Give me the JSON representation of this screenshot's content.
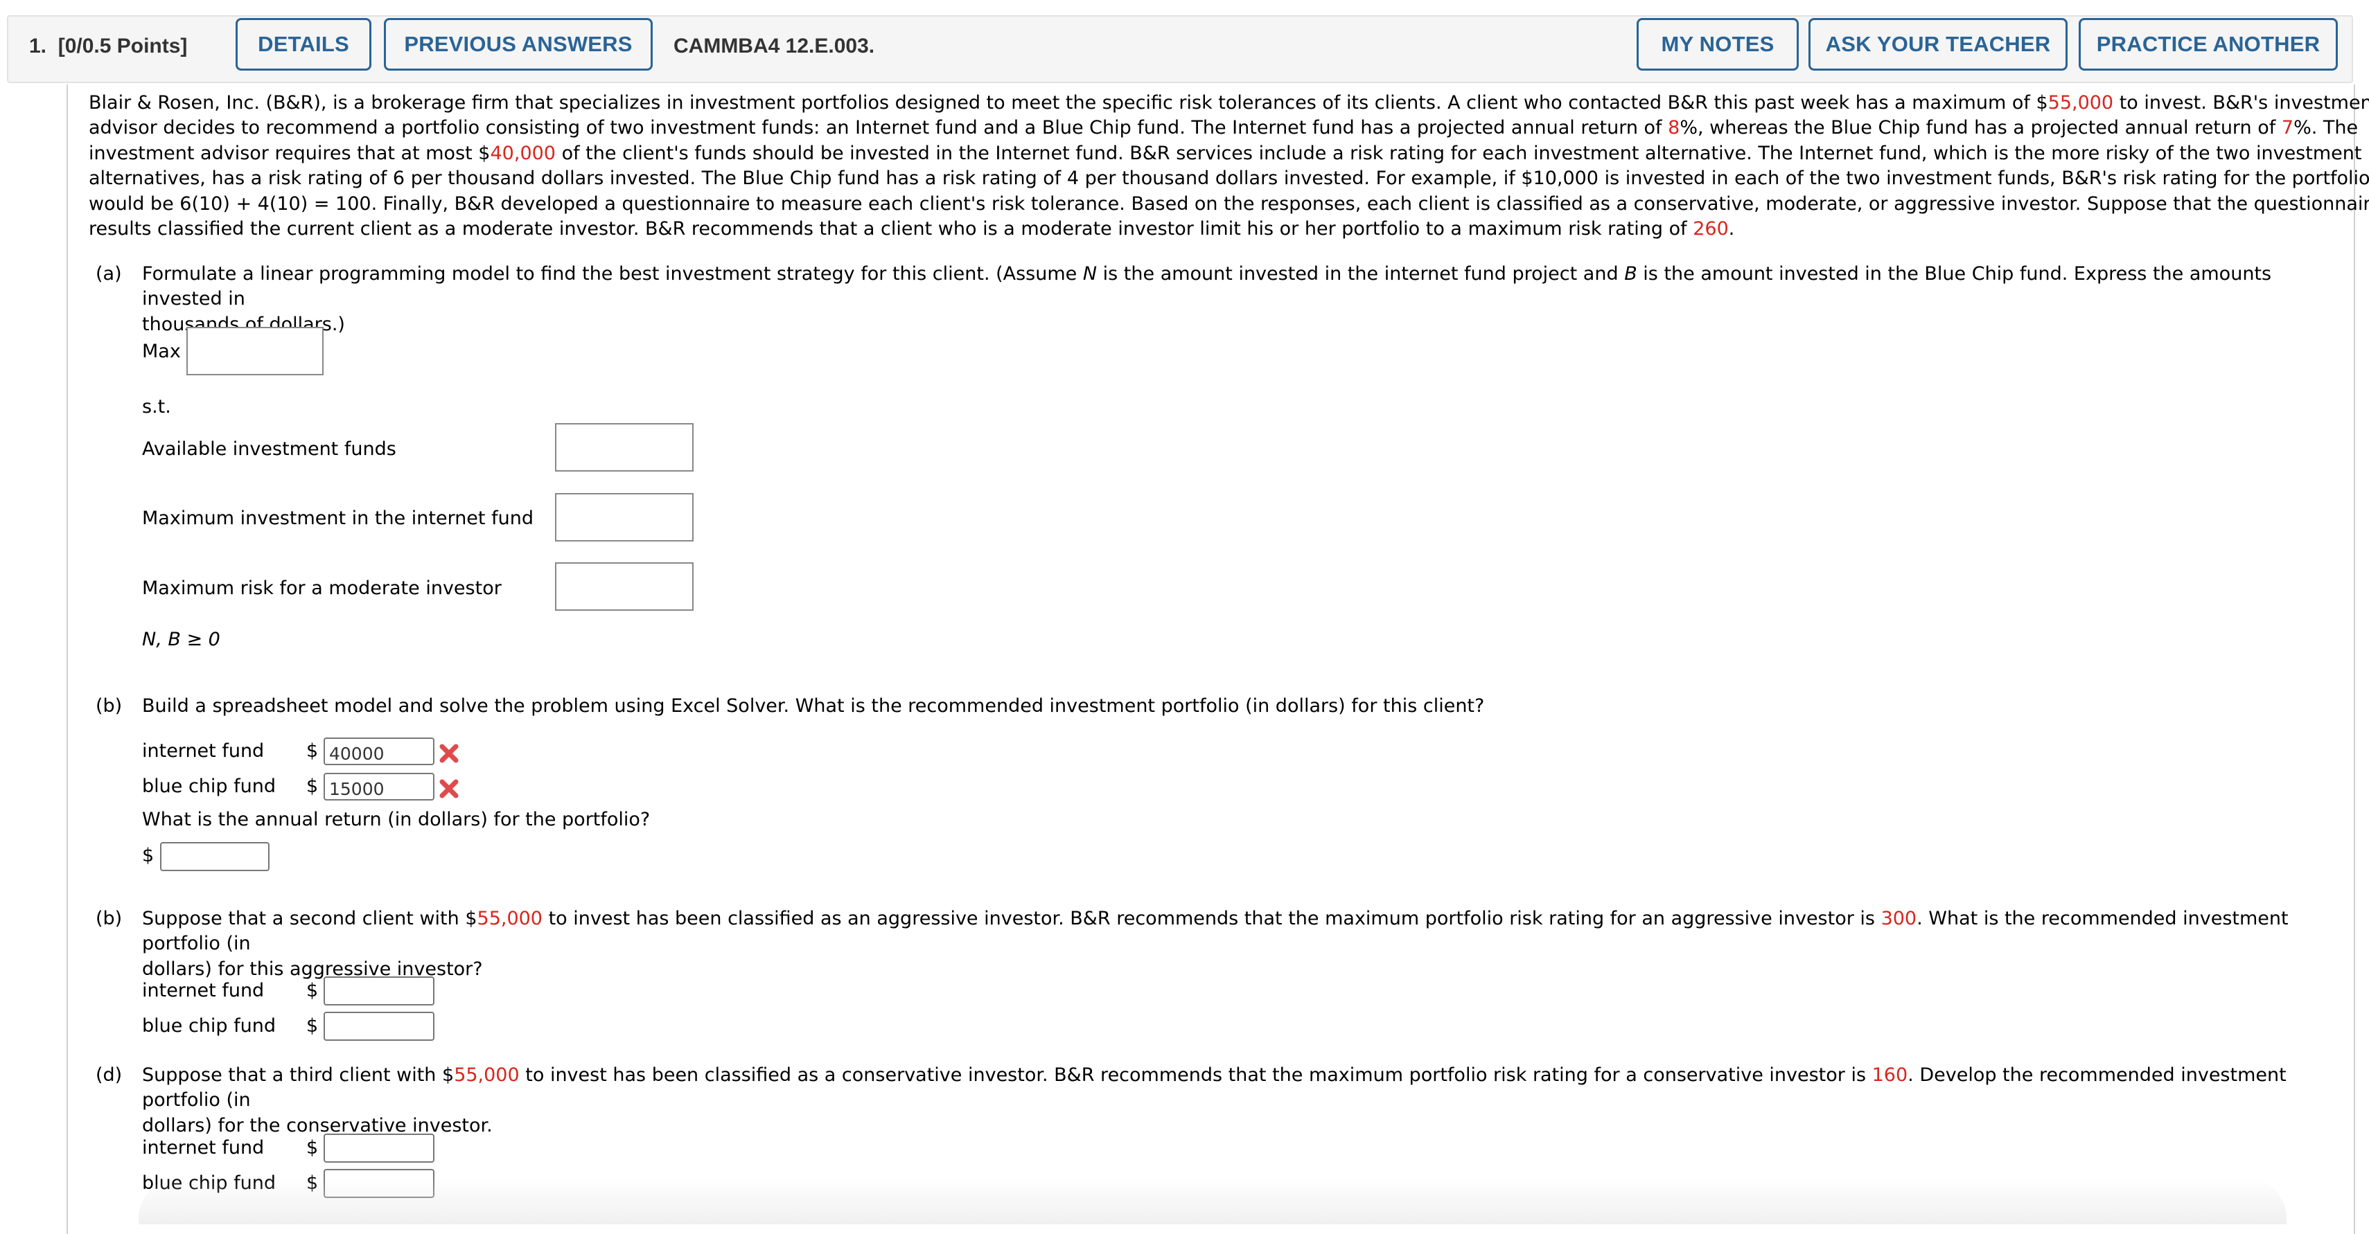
{
  "header": {
    "question_number": "1.",
    "points": "[0/0.5 Points]",
    "buttons": {
      "details": "DETAILS",
      "previous_answers": "PREVIOUS ANSWERS",
      "my_notes": "MY NOTES",
      "ask_teacher": "ASK YOUR TEACHER",
      "practice_another": "PRACTICE ANOTHER"
    },
    "problem_code": "CAMMBA4 12.E.003."
  },
  "intro": {
    "lines": [
      [
        "Blair & Rosen, Inc. (B&R), is a brokerage firm that specializes in investment portfolios designed to meet the specific risk tolerances of its clients. A client who contacted B&R this past week has a maximum of $",
        {
          "red": "55,000"
        },
        " to invest. B&R's investment"
      ],
      [
        "advisor decides to recommend a portfolio consisting of two investment funds: an Internet fund and a Blue Chip fund. The Internet fund has a projected annual return of ",
        {
          "red": "8"
        },
        "%, whereas the Blue Chip fund has a projected annual return of ",
        {
          "red": "7"
        },
        "%. The"
      ],
      [
        "investment advisor requires that at most $",
        {
          "red": "40,000"
        },
        " of the client's funds should be invested in the Internet fund. B&R services include a risk rating for each investment alternative. The Internet fund, which is the more risky of the two investment"
      ],
      [
        "alternatives, has a risk rating of 6 per thousand dollars invested. The Blue Chip fund has a risk rating of 4 per thousand dollars invested. For example, if $10,000 is invested in each of the two investment funds, B&R's risk rating for the portfolio"
      ],
      [
        "would be 6(10) + 4(10) = 100. Finally, B&R developed a questionnaire to measure each client's risk tolerance. Based on the responses, each client is classified as a conservative, moderate, or aggressive investor. Suppose that the questionnaire"
      ],
      [
        "results classified the current client as a moderate investor. B&R recommends that a client who is a moderate investor limit his or her portfolio to a maximum risk rating of ",
        {
          "red": "260"
        },
        "."
      ]
    ],
    "highlighted_values": {
      "max_invest": "55,000",
      "internet_return_pct": "8",
      "bluechip_return_pct": "7",
      "max_internet": "40,000",
      "moderate_max_risk": "260"
    }
  },
  "part_a": {
    "label": "(a)",
    "text_line1": "Formulate a linear programming model to find the best investment strategy for this client. (Assume ",
    "var_n": "N",
    "text_mid": " is the amount invested in the internet fund project and ",
    "var_b": "B",
    "text_end": " is the amount invested in the Blue Chip fund. Express the amounts invested in",
    "text_line2": "thousands of dollars.)",
    "max_label": "Max",
    "max_value": "",
    "st_label": "s.t.",
    "constraints": [
      {
        "label": "Available investment funds",
        "value": ""
      },
      {
        "label": "Maximum investment in the internet fund",
        "value": ""
      },
      {
        "label": "Maximum risk for a moderate investor",
        "value": ""
      }
    ],
    "nonneg": "N, B ≥ 0"
  },
  "part_b1": {
    "label": "(b)",
    "text": "Build a spreadsheet model and solve the problem using Excel Solver. What is the recommended investment portfolio (in dollars) for this client?",
    "rows": [
      {
        "label": "internet fund",
        "currency": "$",
        "value": "40000",
        "status": "incorrect"
      },
      {
        "label": "blue chip fund",
        "currency": "$",
        "value": "15000",
        "status": "incorrect"
      }
    ],
    "return_question": "What is the annual return (in dollars) for the portfolio?",
    "return_currency": "$",
    "return_value": ""
  },
  "part_b2": {
    "label": "(b)",
    "line1_a": "Suppose that a second client with $",
    "line1_red1": "55,000",
    "line1_b": " to invest has been classified as an aggressive investor. B&R recommends that the maximum portfolio risk rating for an aggressive investor is ",
    "line1_red2": "300",
    "line1_c": ". What is the recommended investment portfolio (in",
    "line2": "dollars) for this aggressive investor?",
    "rows": [
      {
        "label": "internet fund",
        "currency": "$",
        "value": ""
      },
      {
        "label": "blue chip fund",
        "currency": "$",
        "value": ""
      }
    ]
  },
  "part_d": {
    "label": "(d)",
    "line1_a": "Suppose that a third client with $",
    "line1_red1": "55,000",
    "line1_b": " to invest has been classified as a conservative investor. B&R recommends that the maximum portfolio risk rating for a conservative investor is ",
    "line1_red2": "160",
    "line1_c": ". Develop the recommended investment portfolio (in",
    "line2": "dollars) for the conservative investor.",
    "rows": [
      {
        "label": "internet fund",
        "currency": "$",
        "value": ""
      },
      {
        "label": "blue chip fund",
        "currency": "$",
        "value": ""
      }
    ]
  },
  "colors": {
    "accent_blue": "#2a6496",
    "highlight_red": "#d9251d",
    "incorrect_icon": "#e04a4a"
  },
  "icons": {
    "incorrect": "x-mark-icon"
  }
}
